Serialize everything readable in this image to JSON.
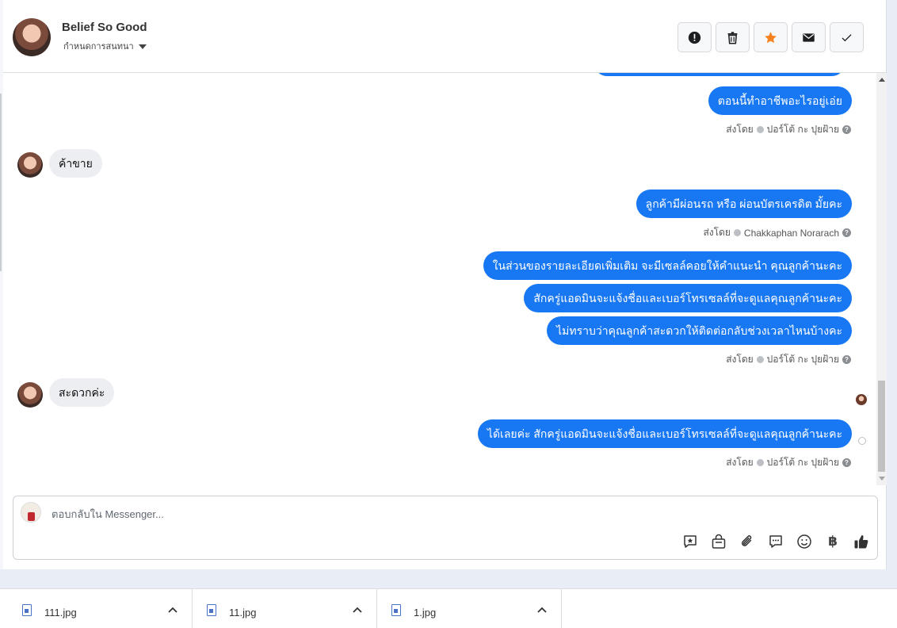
{
  "header": {
    "name": "Belief So Good",
    "subtitle": "กำหนดการสนทนา",
    "buttons": [
      {
        "icon": "alert-icon",
        "color": "#1c1e21"
      },
      {
        "icon": "trash-icon",
        "color": "#1c1e21"
      },
      {
        "icon": "star-icon",
        "color": "#f5821f"
      },
      {
        "icon": "mail-icon",
        "color": "#1c1e21"
      },
      {
        "icon": "checkmark-icon",
        "color": "#1c1e21"
      }
    ]
  },
  "conversation": {
    "messages": [
      {
        "side": "out",
        "text": "ตอนนี้ทำอาชีพอะไรอยู่เอ่ย"
      },
      {
        "side": "meta",
        "prefix": "ส่งโดย",
        "sender": "ปอร์โต้ กะ ปุยฝ้าย"
      },
      {
        "side": "in",
        "text": "ค้าขาย"
      },
      {
        "side": "out",
        "text": "ลูกค้ามีผ่อนรถ หรือ ผ่อนบัตรเครดิต มั้ยคะ"
      },
      {
        "side": "meta",
        "prefix": "ส่งโดย",
        "sender": "Chakkaphan Norarach"
      },
      {
        "side": "out",
        "text": "ในส่วนของรายละเอียดเพิ่มเติม จะมีเซลล์คอยให้คำแนะนำ คุณลูกค้านะคะ"
      },
      {
        "side": "out",
        "text": "สักครู่แอดมินจะแจ้งชื่อและเบอร์โทรเซลล์ที่จะดูแลคุณลูกค้านะคะ"
      },
      {
        "side": "out",
        "text": "ไม่ทราบว่าคุณลูกค้าสะดวกให้ติดต่อกลับช่วงเวลาไหนบ้างคะ"
      },
      {
        "side": "meta",
        "prefix": "ส่งโดย",
        "sender": "ปอร์โต้ กะ ปุยฝ้าย"
      },
      {
        "side": "in",
        "text": "สะดวกค่ะ"
      },
      {
        "side": "out",
        "text": "ได้เลยค่ะ สักครู่แอดมินจะแจ้งชื่อและเบอร์โทรเซลล์ที่จะดูแลคุณลูกค้านะคะ"
      },
      {
        "side": "meta",
        "prefix": "ส่งโดย",
        "sender": "ปอร์โต้ กะ ปุยฝ้าย"
      }
    ]
  },
  "composer": {
    "placeholder": "ตอบกลับใน Messenger...",
    "tools": [
      "saved-reply-icon",
      "shop-bag-icon",
      "attach-icon",
      "chat-bubbles-icon",
      "emoji-icon",
      "baht-icon",
      "like-icon"
    ],
    "baht_symbol": "฿"
  },
  "downloads": [
    {
      "name": "111.jpg"
    },
    {
      "name": "11.jpg"
    },
    {
      "name": "1.jpg"
    }
  ],
  "colors": {
    "accent": "#1877f2",
    "star": "#f5821f"
  }
}
